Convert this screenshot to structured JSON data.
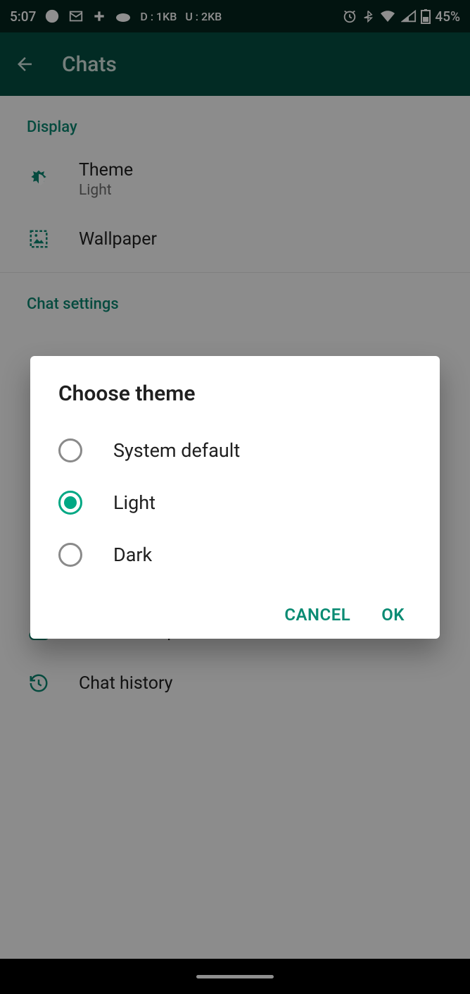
{
  "status": {
    "time": "5:07",
    "net_down": "D : 1KB",
    "net_up": "U : 2KB",
    "battery_pct": "45%"
  },
  "appbar": {
    "title": "Chats"
  },
  "sections": {
    "display": {
      "header": "Display",
      "theme_label": "Theme",
      "theme_value": "Light",
      "wallpaper_label": "Wallpaper"
    },
    "chat": {
      "header": "Chat settings",
      "backup_label": "Chat backup",
      "history_label": "Chat history"
    }
  },
  "dialog": {
    "title": "Choose theme",
    "options": {
      "system": "System default",
      "light": "Light",
      "dark": "Dark"
    },
    "selected": "light",
    "cancel": "CANCEL",
    "ok": "OK"
  }
}
